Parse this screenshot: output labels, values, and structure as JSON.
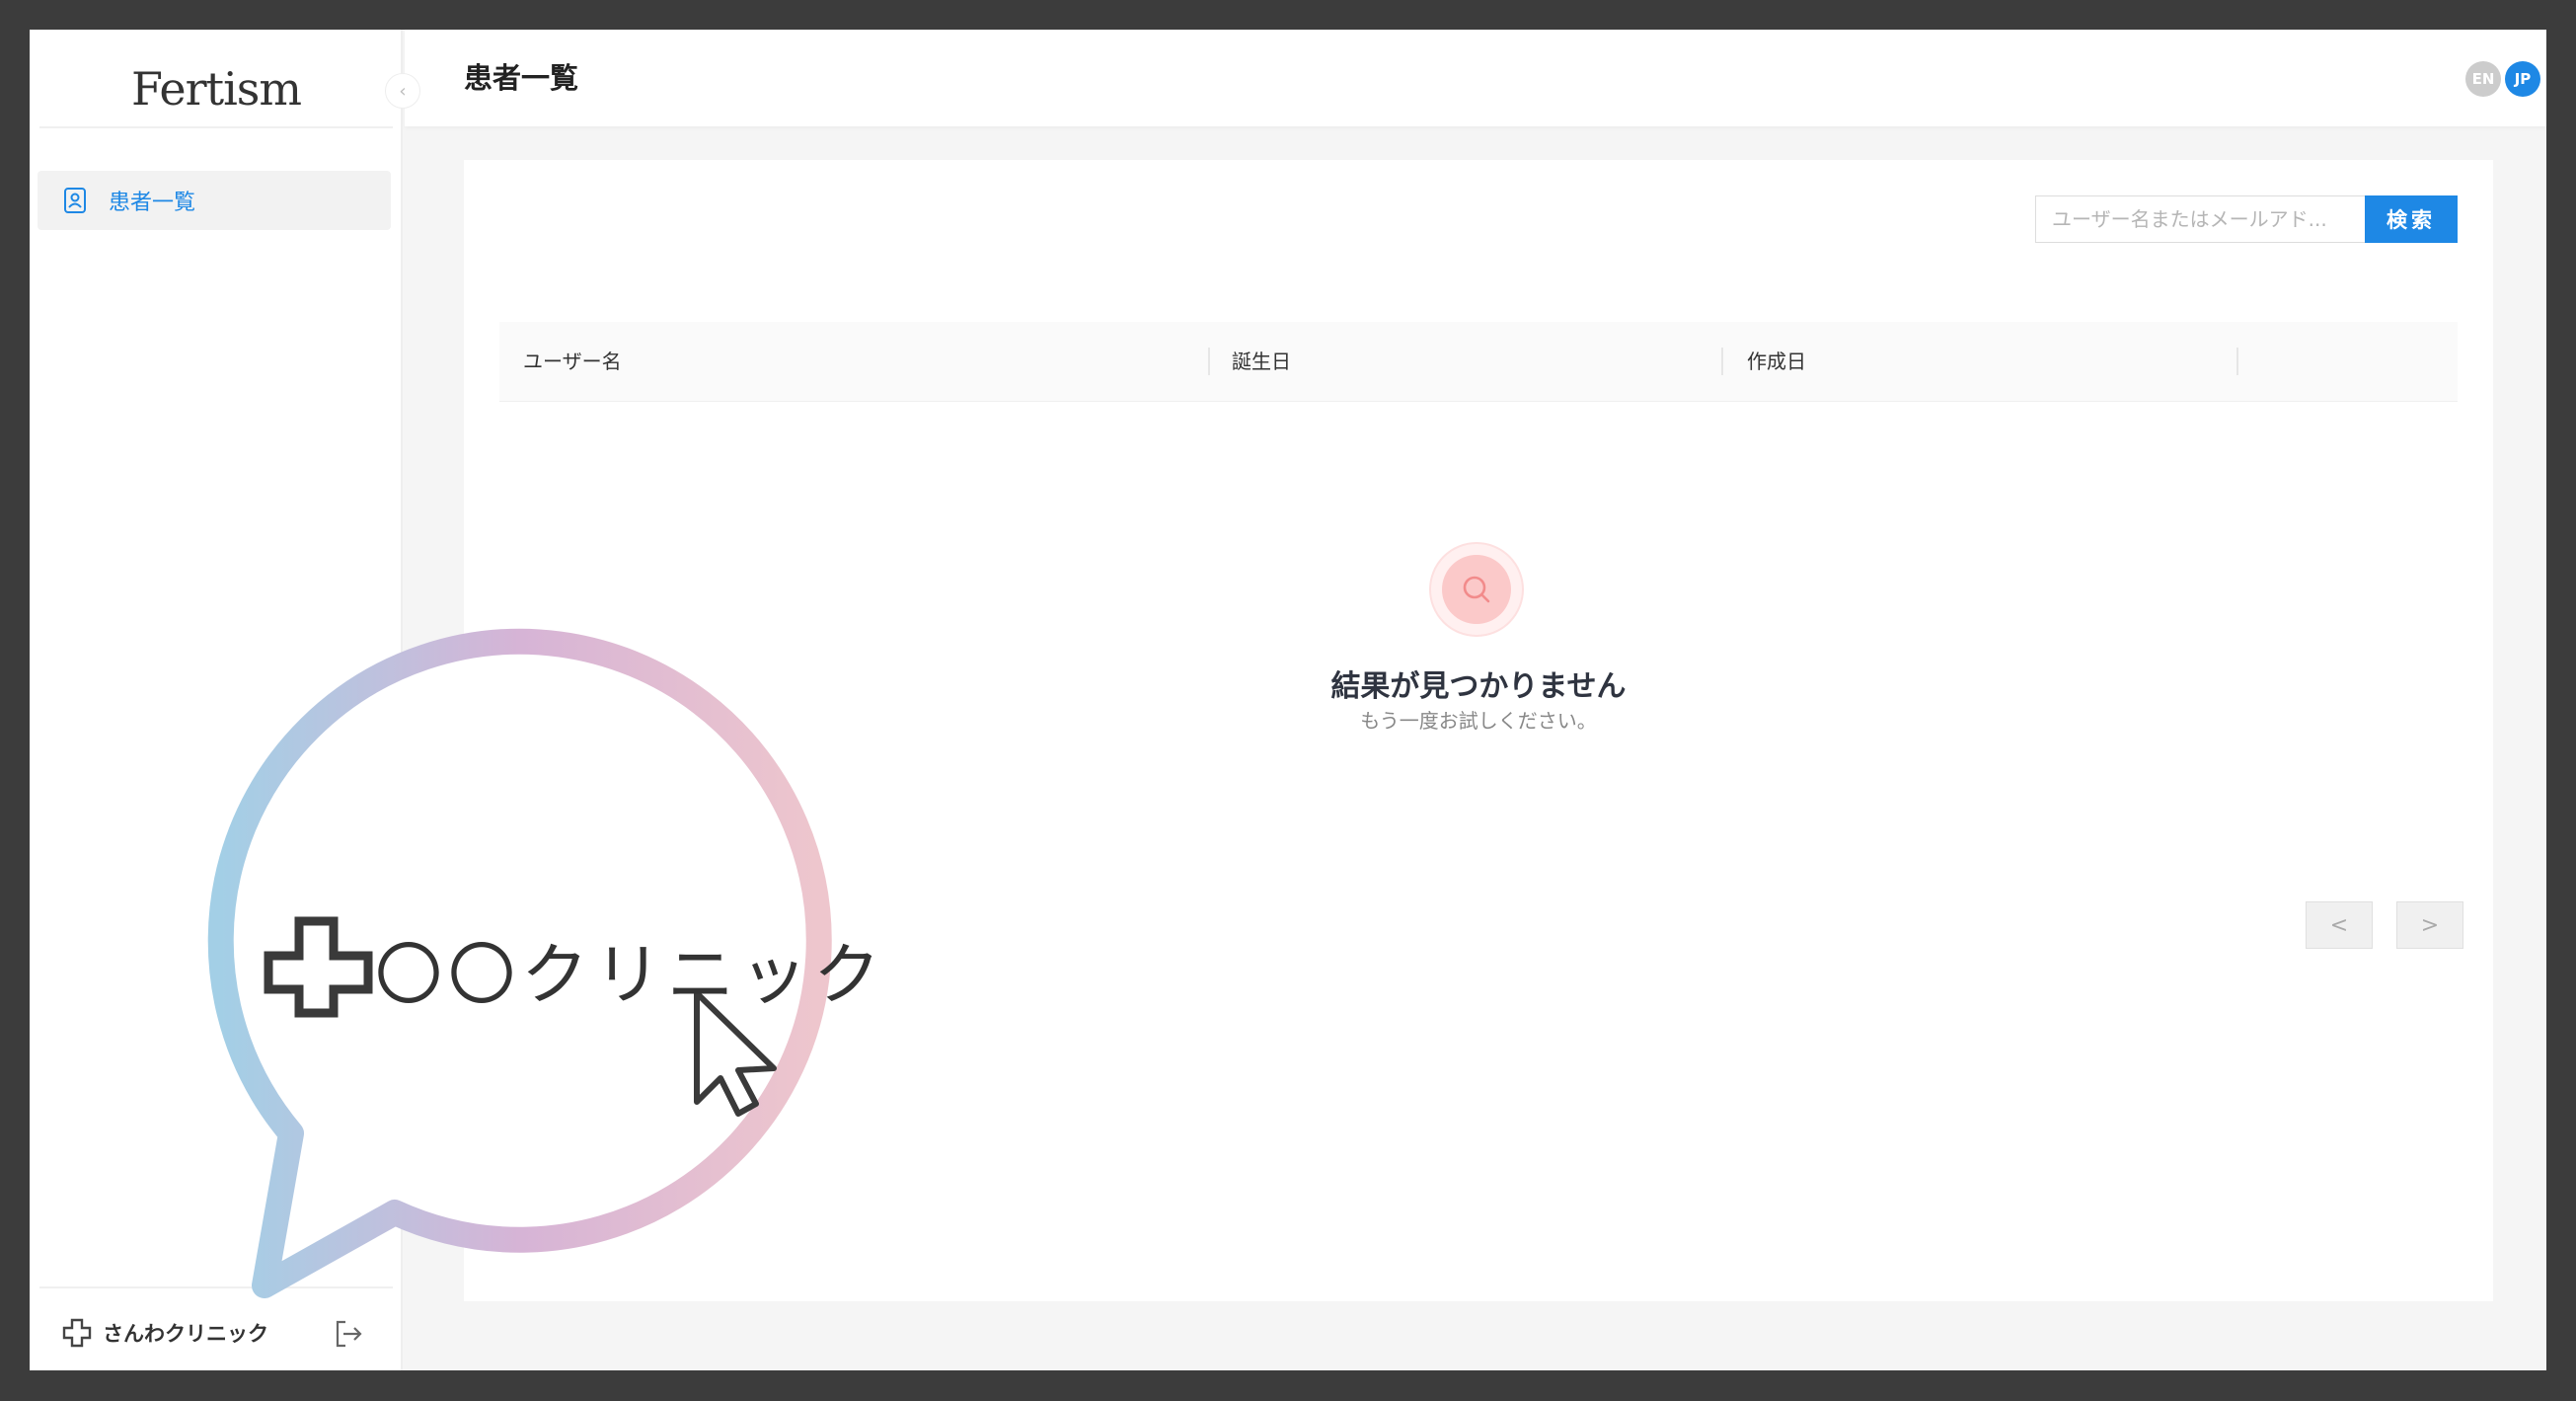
{
  "app": {
    "logo_text": "Fertism",
    "colors": {
      "primary": "#1e88e5",
      "logo_accent": "#ea6a8f",
      "empty_icon": "#f28b8b"
    }
  },
  "sidebar": {
    "items": [
      {
        "label": "患者一覧",
        "icon": "patient-card-icon",
        "active": true
      }
    ],
    "collapse_icon": "chevron-left-icon",
    "footer": {
      "clinic_name": "さんわクリニック",
      "clinic_icon": "medical-cross-icon",
      "logout_icon": "logout-icon"
    }
  },
  "header": {
    "title": "患者一覧",
    "languages": [
      {
        "code": "EN",
        "active": false
      },
      {
        "code": "JP",
        "active": true
      }
    ]
  },
  "search": {
    "placeholder": "ユーザー名またはメールアド...",
    "value": "",
    "button_label": "検索"
  },
  "table": {
    "columns": [
      "ユーザー名",
      "誕生日",
      "作成日"
    ],
    "rows": []
  },
  "empty_state": {
    "icon": "search-icon",
    "title": "結果が見つかりません",
    "subtitle": "もう一度お試しください。"
  },
  "pagination": {
    "prev_label": "<",
    "next_label": ">"
  },
  "callout": {
    "text": "〇〇クリニック",
    "icon": "medical-cross-icon",
    "cursor_icon": "mouse-pointer-icon"
  }
}
